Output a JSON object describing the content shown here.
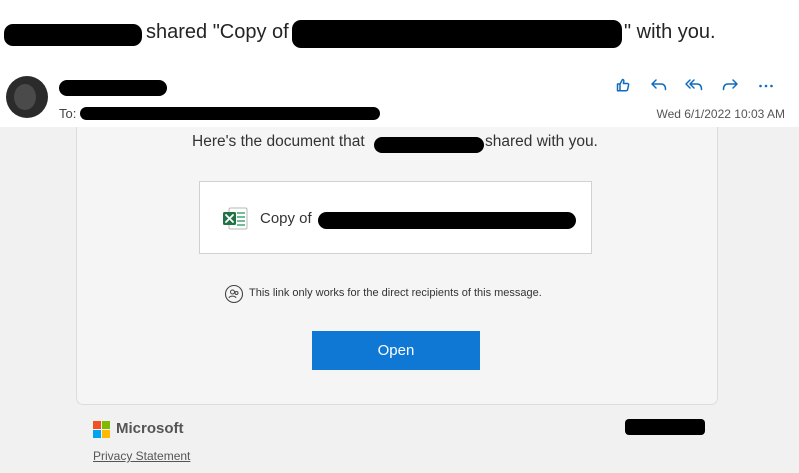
{
  "subject": {
    "part1": "shared \"Copy of",
    "part2": "\" with you."
  },
  "header": {
    "to_label": "To:",
    "date": "Wed 6/1/2022 10:03 AM",
    "actions": [
      {
        "name": "like",
        "icon": "thumbs-up-icon"
      },
      {
        "name": "reply",
        "icon": "reply-icon"
      },
      {
        "name": "reply-all",
        "icon": "reply-all-icon"
      },
      {
        "name": "forward",
        "icon": "forward-icon"
      },
      {
        "name": "more",
        "icon": "more-icon"
      }
    ]
  },
  "message": {
    "intro_prefix": "Here's the document that",
    "intro_suffix": "shared with you.",
    "document_prefix": "Copy of",
    "notice": "This link only works for the direct recipients of this message.",
    "open_label": "Open"
  },
  "footer": {
    "brand": "Microsoft",
    "privacy": "Privacy Statement"
  },
  "colors": {
    "accent": "#0f6cbd",
    "button": "#0f78d4",
    "excel": "#217346"
  }
}
